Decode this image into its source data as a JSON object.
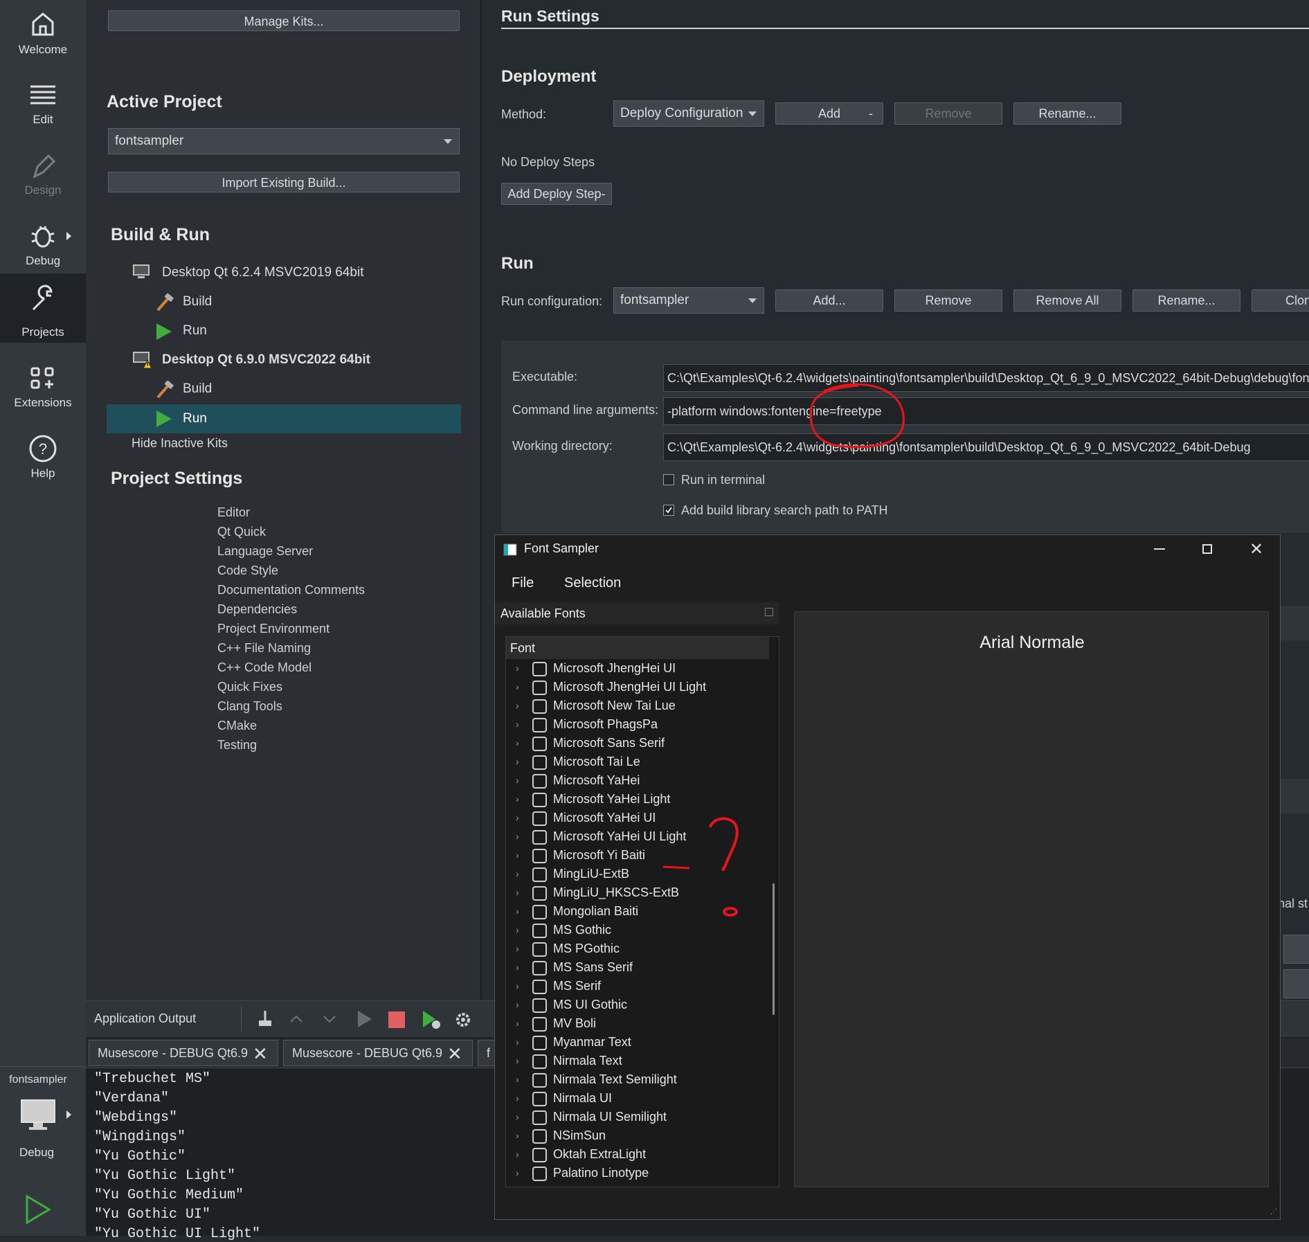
{
  "modebar": {
    "items": [
      {
        "label": "Welcome",
        "icon": "home-icon"
      },
      {
        "label": "Edit",
        "icon": "edit-lines-icon"
      },
      {
        "label": "Design",
        "icon": "pen-icon"
      },
      {
        "label": "Debug",
        "icon": "bug-icon"
      },
      {
        "label": "Projects",
        "icon": "wrench-icon"
      },
      {
        "label": "Extensions",
        "icon": "extensions-grid-icon"
      },
      {
        "label": "Help",
        "icon": "help-circle-icon"
      }
    ],
    "target": {
      "project": "fontsampler",
      "config": "Debug"
    }
  },
  "projects": {
    "manage_kits": "Manage Kits...",
    "active_project_title": "Active Project",
    "active_project_value": "fontsampler",
    "import_build": "Import Existing Build...",
    "build_run_title": "Build & Run",
    "kit1": {
      "name": "Desktop Qt 6.2.4 MSVC2019 64bit",
      "build": "Build",
      "run": "Run"
    },
    "kit2": {
      "name": "Desktop Qt 6.9.0 MSVC2022 64bit",
      "build": "Build",
      "run": "Run"
    },
    "hide_inactive": "Hide Inactive Kits",
    "project_settings_title": "Project Settings",
    "settings": [
      "Editor",
      "Qt Quick",
      "Language Server",
      "Code Style",
      "Documentation Comments",
      "Dependencies",
      "Project Environment",
      "C++ File Naming",
      "C++ Code Model",
      "Quick Fixes",
      "Clang Tools",
      "CMake",
      "Testing"
    ]
  },
  "run_settings": {
    "title": "Run Settings",
    "deployment_title": "Deployment",
    "method_label": "Method:",
    "method_value": "Deploy Configuration",
    "add": "Add",
    "remove_disabled": "Remove",
    "rename": "Rename...",
    "no_deploy_steps": "No Deploy Steps",
    "add_deploy_step": "Add Deploy Step",
    "run_title": "Run",
    "run_config_label": "Run configuration:",
    "run_config_value": "fontsampler",
    "add_ellipsis": "Add...",
    "remove": "Remove",
    "remove_all": "Remove All",
    "rename2": "Rename...",
    "clone": "Clon",
    "executable_label": "Executable:",
    "executable_value": "C:\\Qt\\Examples\\Qt-6.2.4\\widgets\\painting\\fontsampler\\build\\Desktop_Qt_6_9_0_MSVC2022_64bit-Debug\\debug\\font",
    "args_label": "Command line arguments:",
    "args_value": "-platform windows:fontengine=freetype",
    "workdir_label": "Working directory:",
    "workdir_value": "C:\\Qt\\Examples\\Qt-6.2.4\\widgets\\painting\\fontsampler\\build\\Desktop_Qt_6_9_0_MSVC2022_64bit-Debug",
    "run_in_terminal": "Run in terminal",
    "add_lib_path": "Add build library search path to PATH",
    "partial_right_text": "nal st"
  },
  "output": {
    "title": "Application Output",
    "tabs": [
      "Musescore - DEBUG Qt6.9",
      "Musescore - DEBUG Qt6.9",
      "f"
    ],
    "lines": [
      "\"Trebuchet MS\"",
      "\"Verdana\"",
      "\"Webdings\"",
      "\"Wingdings\"",
      "\"Yu Gothic\"",
      "\"Yu Gothic Light\"",
      "\"Yu Gothic Medium\"",
      "\"Yu Gothic UI\"",
      "\"Yu Gothic UI Light\""
    ]
  },
  "font_sampler": {
    "title": "Font Sampler",
    "menu": [
      "File",
      "Selection"
    ],
    "dock_title": "Available Fonts",
    "column_header": "Font",
    "fonts": [
      "Microsoft JhengHei UI",
      "Microsoft JhengHei UI Light",
      "Microsoft New Tai Lue",
      "Microsoft PhagsPa",
      "Microsoft Sans Serif",
      "Microsoft Tai Le",
      "Microsoft YaHei",
      "Microsoft YaHei Light",
      "Microsoft YaHei UI",
      "Microsoft YaHei UI Light",
      "Microsoft Yi Baiti",
      "MingLiU-ExtB",
      "MingLiU_HKSCS-ExtB",
      "Mongolian Baiti",
      "MS Gothic",
      "MS PGothic",
      "MS Sans Serif",
      "MS Serif",
      "MS UI Gothic",
      "MV Boli",
      "Myanmar Text",
      "Nirmala Text",
      "Nirmala Text Semilight",
      "Nirmala UI",
      "Nirmala UI Semilight",
      "NSimSun",
      "Oktah ExtraLight",
      "Palatino Linotype"
    ],
    "preview_text": "Arial Normale"
  },
  "colors": {
    "accent_selection": "#1f4f5a",
    "annotation_red": "#e8141c",
    "run_green": "#3fae3f"
  }
}
